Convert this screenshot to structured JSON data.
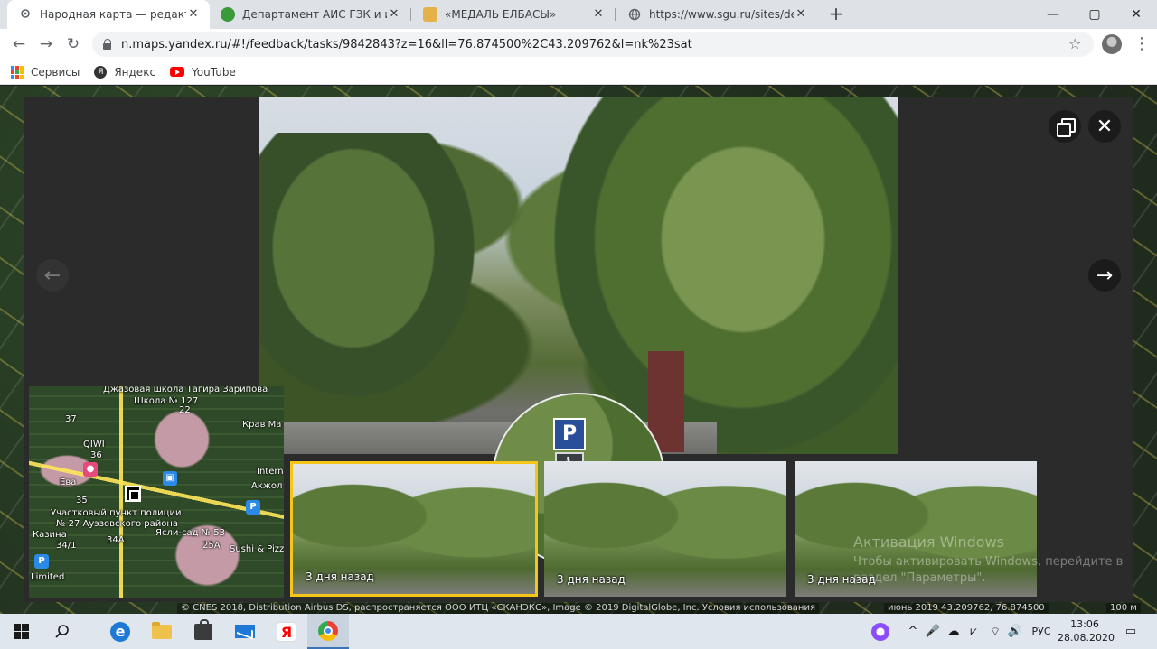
{
  "browser": {
    "tabs": [
      {
        "title": "Народная карта — редактор Ян",
        "favicon": "location-pin-icon",
        "active": true
      },
      {
        "title": "Департамент АИС ГЗК и инфор",
        "favicon": "green-globe-icon",
        "active": false
      },
      {
        "title": "«МЕДАЛЬ ЕЛБАСЫ»",
        "favicon": "emblem-icon",
        "active": false
      },
      {
        "title": "https://www.sgu.ru/sites/default/",
        "favicon": "globe-icon",
        "active": false
      }
    ],
    "new_tab": "+",
    "window_controls": {
      "minimize": "—",
      "maximize": "▢",
      "close": "✕"
    },
    "url": "n.maps.yandex.ru/#!/feedback/tasks/9842843?z=16&ll=76.874500%2C43.209762&l=nk%23sat",
    "bookmarks": [
      {
        "label": "Сервисы",
        "icon": "apps-grid-icon"
      },
      {
        "label": "Яндекс",
        "icon": "yandex-icon"
      },
      {
        "label": "YouTube",
        "icon": "youtube-icon"
      }
    ]
  },
  "viewer": {
    "prev_icon": "←",
    "next_icon": "→",
    "close_icon": "✕",
    "magnifier": {
      "sign_p": "P",
      "sign_arrow": "→",
      "sign_person": "♿"
    },
    "thumbnails": [
      {
        "caption": "3 дня назад",
        "selected": true
      },
      {
        "caption": "3 дня назад",
        "selected": false
      },
      {
        "caption": "3 дня назад",
        "selected": false
      }
    ]
  },
  "minimap": {
    "labels": [
      "Джазовая школа Тагира Зарипова",
      "Школа № 127",
      "22",
      "37",
      "QIWI",
      "36",
      "Ева",
      "35",
      "Участковый пункт полиции",
      "№ 27 Ауэзовского района",
      "Казина",
      "34/1",
      "34А",
      "Ясли-сад № 53",
      "25А",
      "Limited",
      "Sushi & Pizz",
      "Акжол",
      "Intern",
      "Крав Ма"
    ]
  },
  "watermark": {
    "line1": "Активация Windows",
    "line2": "Чтобы активировать Windows, перейдите в",
    "line3": "раздел \"Параметры\"."
  },
  "footer": {
    "copyright": "© CNES 2018, Distribution Airbus DS, распространяется ООО ИТЦ «СКАНЭКС», Image © 2019 DigitalGlobe, Inc. Условия использования",
    "date_coords": "июнь 2019   43.209762, 76.874500",
    "scale": "100 м"
  },
  "taskbar": {
    "lang": "РУС",
    "time": "13:06",
    "date": "28.08.2020",
    "chevron": "^"
  }
}
